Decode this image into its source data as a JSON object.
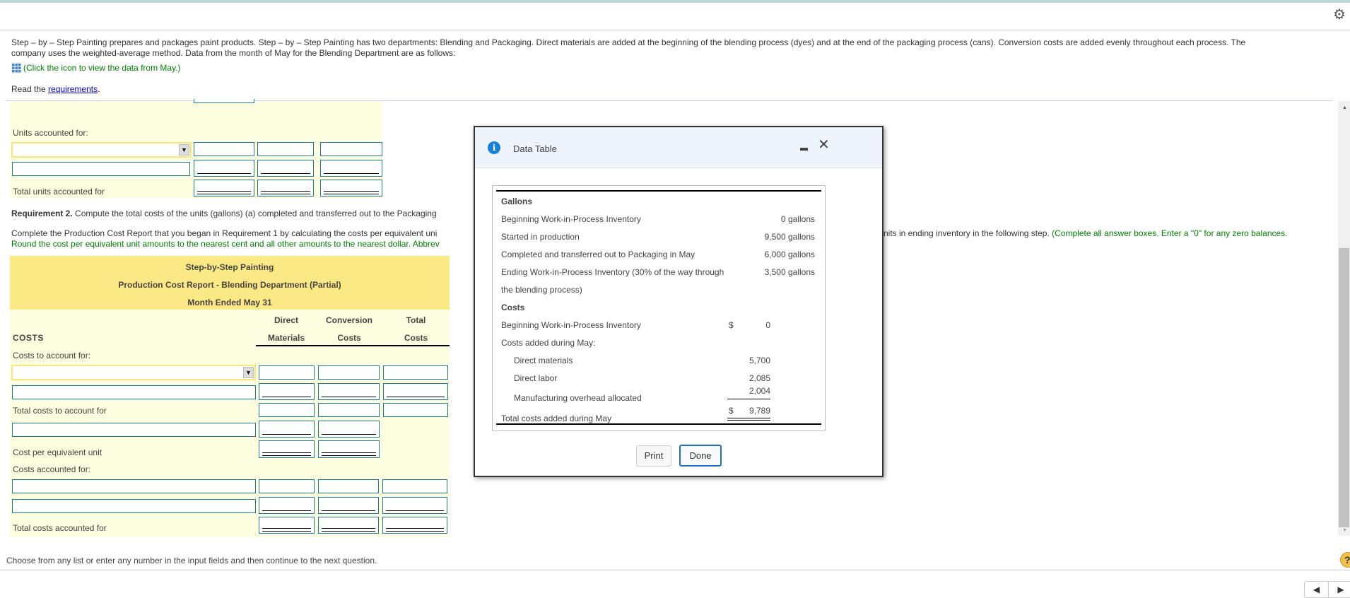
{
  "intro": {
    "line1": "Step – by – Step Painting prepares and packages paint products. Step – by – Step Painting has two departments: Blending and Packaging. Direct materials are added at the beginning of the blending process (dyes) and at the end of the packaging process (cans). Conversion costs are added evenly throughout each process. The",
    "line2": "company uses the weighted-average method. Data from the month of May for the Blending Department are as follows:",
    "click": "(Click the icon to view the data from May.)",
    "read_prefix": "Read the ",
    "read_link": "requirements",
    "read_suffix": "."
  },
  "units": {
    "label": "Units accounted for:",
    "total": "Total units accounted for"
  },
  "req2": {
    "bold": "Requirement 2.",
    "text": " Compute the total costs of the units (gallons) (a) completed and transferred out to the Packaging",
    "complete": "Complete the Production Cost Report that you began in Requirement 1 by calculating the costs per equivalent uni",
    "complete_right": "nits in ending inventory in the following step.",
    "note_right": " (Complete all answer boxes. Enter a \"0\" for any zero balances.",
    "note": "Round the cost per equivalent unit amounts to the nearest cent and all other amounts to the nearest dollar. Abbrev"
  },
  "report": {
    "company": "Step-by-Step Painting",
    "title": "Production Cost Report - Blending Department (Partial)",
    "period": "Month Ended May 31",
    "costs": "COSTS",
    "col1a": "Direct",
    "col1b": "Materials",
    "col2a": "Conversion",
    "col2b": "Costs",
    "col3a": "Total",
    "col3b": "Costs",
    "to_account": "Costs to account for:",
    "total_to_account": "Total costs to account for",
    "per_unit": "Cost per equivalent unit",
    "accounted": "Costs accounted for:",
    "total_accounted": "Total costs accounted for"
  },
  "footer": {
    "instruction": "Choose from any list or enter any number in the input fields and then continue to the next question."
  },
  "dialog": {
    "title": "Data Table",
    "gallons_header": "Gallons",
    "gallons": [
      {
        "label": "Beginning Work-in-Process Inventory",
        "value": "0 gallons"
      },
      {
        "label": "Started in production",
        "value": "9,500 gallons"
      },
      {
        "label": "Completed and transferred out to Packaging in May",
        "value": "6,000 gallons"
      },
      {
        "label": "Ending Work-in-Process Inventory (30% of the way through",
        "value": "3,500 gallons"
      }
    ],
    "gallons_cont": "the blending process)",
    "costs_header": "Costs",
    "beg": {
      "label": "Beginning Work-in-Process Inventory",
      "cur": "$",
      "value": "0"
    },
    "added": "Costs added during May:",
    "items": [
      {
        "label": "Direct materials",
        "value": "5,700"
      },
      {
        "label": "Direct labor",
        "value": "2,085"
      },
      {
        "label": "Manufacturing overhead allocated",
        "value": "2,004"
      }
    ],
    "total": {
      "label": "Total costs added during May",
      "cur": "$",
      "value": "9,789"
    },
    "print": "Print",
    "done": "Done"
  },
  "help": "?"
}
